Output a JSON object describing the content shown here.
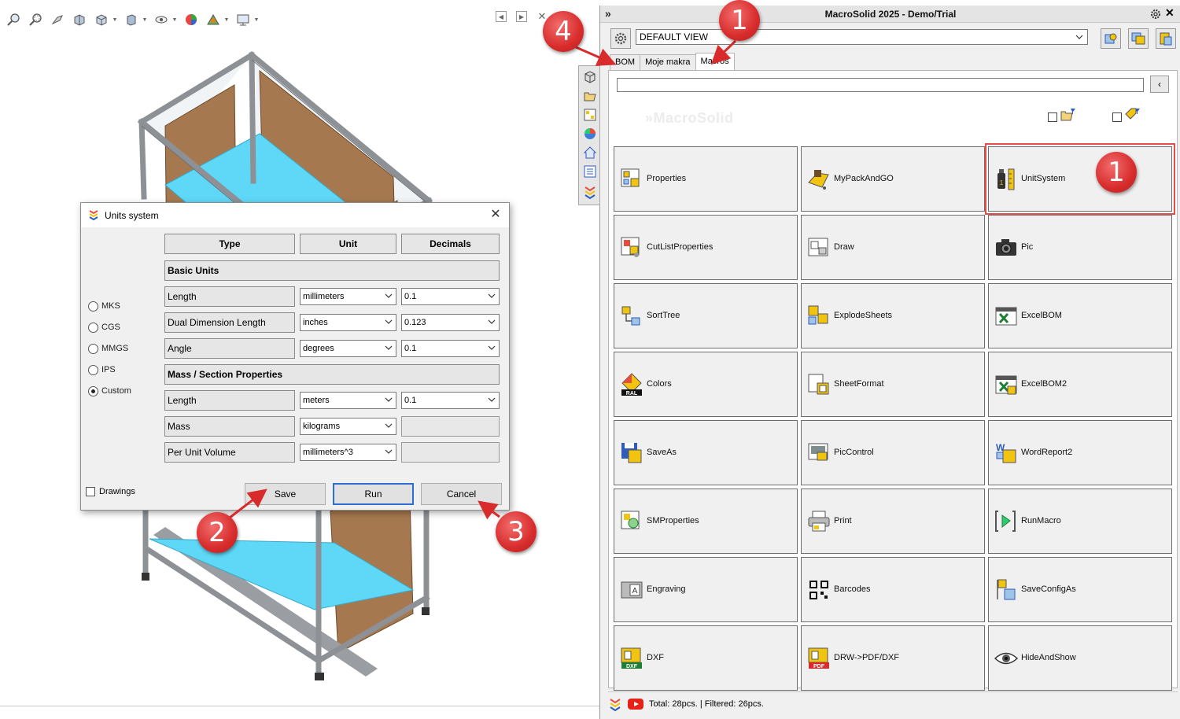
{
  "panel": {
    "title": "MacroSolid 2025 - Demo/Trial",
    "collapse_glyph": "»",
    "close_glyph": "✕",
    "view_select": {
      "value": "DEFAULT VIEW"
    },
    "tabs": [
      {
        "label": "BOM",
        "active": false
      },
      {
        "label": "Moje makra",
        "active": false
      },
      {
        "label": "Macros",
        "active": true
      }
    ],
    "search": {
      "value": "",
      "back_glyph": "‹"
    },
    "watermark": "»MacroSolid",
    "macros": [
      {
        "label": "Properties",
        "icon": "properties-icon"
      },
      {
        "label": "MyPackAndGO",
        "icon": "pack-and-go-icon"
      },
      {
        "label": "UnitSystem",
        "icon": "unit-system-icon"
      },
      {
        "label": "CutListProperties",
        "icon": "cutlist-properties-icon"
      },
      {
        "label": "Draw",
        "icon": "draw-icon"
      },
      {
        "label": "Pic",
        "icon": "camera-icon"
      },
      {
        "label": "SortTree",
        "icon": "sort-tree-icon"
      },
      {
        "label": "ExplodeSheets",
        "icon": "explode-sheets-icon"
      },
      {
        "label": "ExcelBOM",
        "icon": "excel-bom-icon"
      },
      {
        "label": "Colors",
        "icon": "colors-ral-icon"
      },
      {
        "label": "SheetFormat",
        "icon": "sheet-format-icon"
      },
      {
        "label": "ExcelBOM2",
        "icon": "excel-bom2-icon"
      },
      {
        "label": "SaveAs",
        "icon": "save-as-icon"
      },
      {
        "label": "PicControl",
        "icon": "pic-control-icon"
      },
      {
        "label": "WordReport2",
        "icon": "word-report-icon"
      },
      {
        "label": "SMProperties",
        "icon": "sm-properties-icon"
      },
      {
        "label": "Print",
        "icon": "printer-icon"
      },
      {
        "label": "RunMacro",
        "icon": "run-macro-icon"
      },
      {
        "label": "Engraving",
        "icon": "engraving-icon"
      },
      {
        "label": "Barcodes",
        "icon": "barcode-icon"
      },
      {
        "label": "SaveConfigAs",
        "icon": "save-config-icon"
      },
      {
        "label": "DXF",
        "icon": "dxf-icon"
      },
      {
        "label": "DRW->PDF/DXF",
        "icon": "drw-pdf-dxf-icon"
      },
      {
        "label": "HideAndShow",
        "icon": "eye-icon"
      }
    ],
    "status": "Total: 28pcs. | Filtered: 26pcs."
  },
  "dialog": {
    "title": "Units system",
    "close_glyph": "✕",
    "headers": {
      "type": "Type",
      "unit": "Unit",
      "decimals": "Decimals"
    },
    "sections": {
      "basic": "Basic Units",
      "mass": "Mass / Section Properties"
    },
    "rows": [
      {
        "label": "Length",
        "unit": "millimeters",
        "decimals": "0.1"
      },
      {
        "label": "Dual Dimension Length",
        "unit": "inches",
        "decimals": "0.123"
      },
      {
        "label": "Angle",
        "unit": "degrees",
        "decimals": "0.1"
      },
      {
        "label": "Length",
        "unit": "meters",
        "decimals": "0.1"
      },
      {
        "label": "Mass",
        "unit": "kilograms",
        "decimals": ""
      },
      {
        "label": "Per Unit Volume",
        "unit": "millimeters^3",
        "decimals": ""
      }
    ],
    "unit_systems": [
      {
        "label": "MKS",
        "selected": false
      },
      {
        "label": "CGS",
        "selected": false
      },
      {
        "label": "MMGS",
        "selected": false
      },
      {
        "label": "IPS",
        "selected": false
      },
      {
        "label": "Custom",
        "selected": true
      }
    ],
    "drawings_label": "Drawings",
    "buttons": {
      "save": "Save",
      "run": "Run",
      "cancel": "Cancel"
    }
  },
  "callouts": [
    "4",
    "1",
    "1",
    "2",
    "3"
  ],
  "colors": {
    "callout": "#d82c2c",
    "highlight": "#e74c4c",
    "glass": "#5fd7f7",
    "wood": "#a5784f",
    "frame": "#9a9ea3"
  }
}
